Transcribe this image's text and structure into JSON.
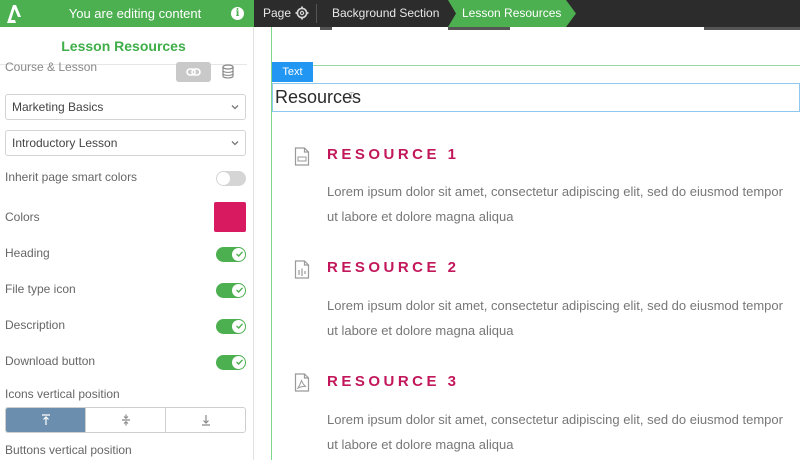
{
  "topbar": {
    "edit_title": "You are editing content",
    "breadcrumb": [
      "Page",
      "Background Section",
      "Lesson Resources"
    ],
    "colors": {
      "editor_green": "#4caf50",
      "bar_dark": "#2c2c2c"
    }
  },
  "sidebar": {
    "panel_title": "Lesson Resources",
    "course_label": "Course & Lesson",
    "course_select": "Marketing Basics",
    "lesson_select": "Introductory Lesson",
    "options": [
      {
        "label": "Inherit page smart colors",
        "control": "toggle",
        "on": false
      },
      {
        "label": "Colors",
        "control": "swatch",
        "color": "#d81b60"
      },
      {
        "label": "Heading",
        "control": "toggle",
        "on": true
      },
      {
        "label": "File type icon",
        "control": "toggle",
        "on": true
      },
      {
        "label": "Description",
        "control": "toggle",
        "on": true
      },
      {
        "label": "Download button",
        "control": "toggle",
        "on": true
      }
    ],
    "icons_position_label": "Icons vertical position",
    "icons_position_options": [
      "top",
      "middle",
      "bottom"
    ],
    "icons_position_selected": "top",
    "buttons_position_label": "Buttons vertical position"
  },
  "canvas": {
    "text_tag": "Text",
    "heading": "Resources",
    "resources": [
      {
        "title": "RESOURCE 1",
        "icon": "document-file-icon",
        "desc_line1": "Lorem ipsum dolor sit amet, consectetur adipiscing elit, sed do eiusmod tempor",
        "desc_line2": "ut labore et dolore magna aliqua"
      },
      {
        "title": "RESOURCE 2",
        "icon": "audio-file-icon",
        "desc_line1": "Lorem ipsum dolor sit amet, consectetur adipiscing elit, sed do eiusmod tempor",
        "desc_line2": "ut labore et dolore magna aliqua"
      },
      {
        "title": "RESOURCE 3",
        "icon": "pdf-file-icon",
        "desc_line1": "Lorem ipsum dolor sit amet, consectetur adipiscing elit, sed do eiusmod tempor",
        "desc_line2": "ut labore et dolore magna aliqua"
      }
    ],
    "accent_color": "#c2185b"
  }
}
